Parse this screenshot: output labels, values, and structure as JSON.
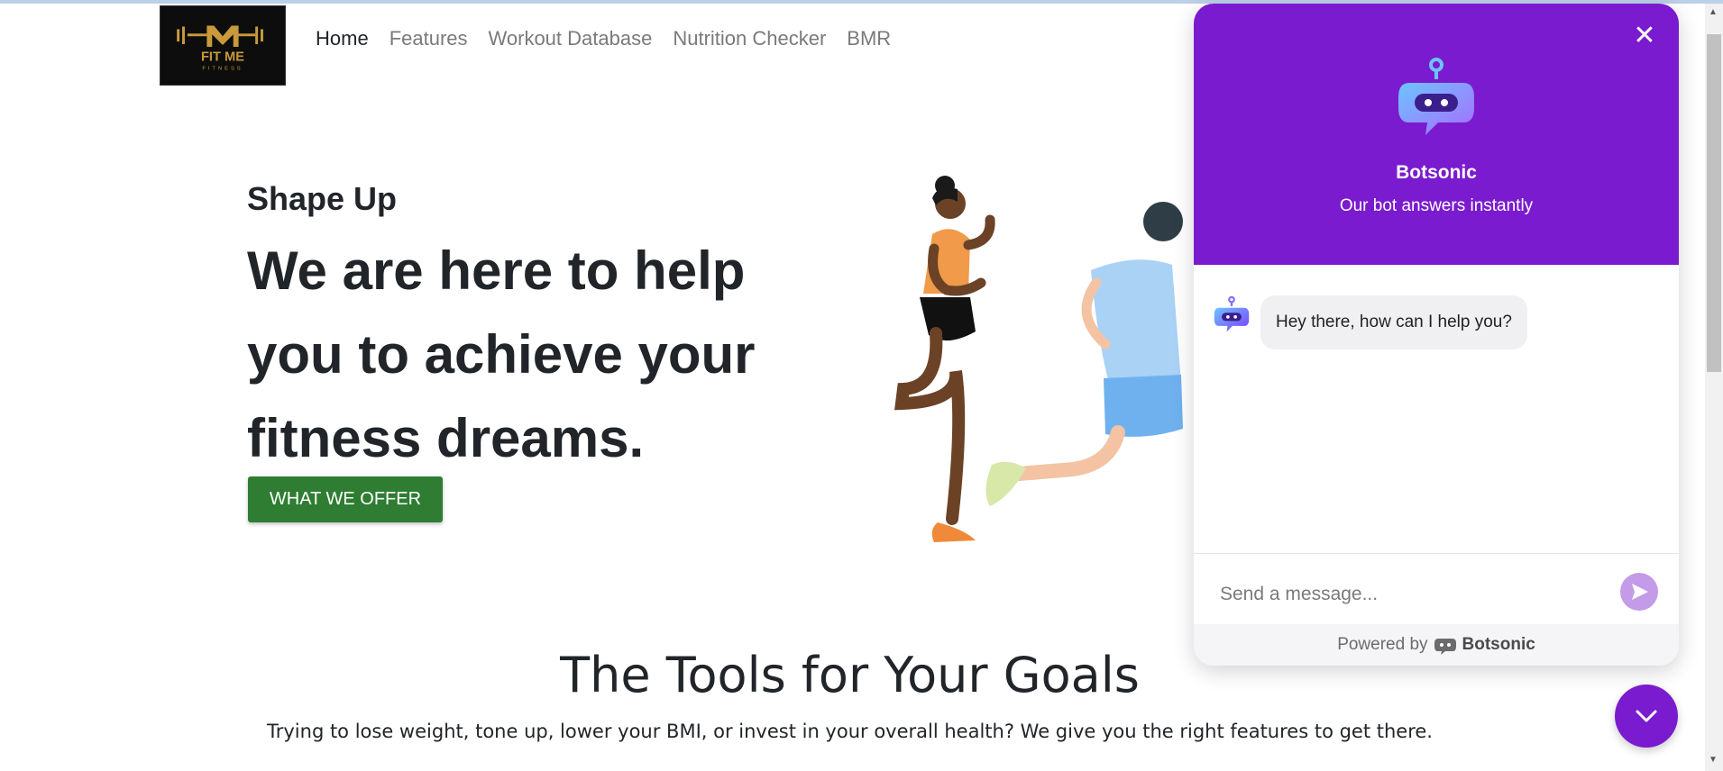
{
  "brand": {
    "logo_text": "FIT ME",
    "logo_subtext": "FITNESS"
  },
  "nav": {
    "items": [
      {
        "label": "Home",
        "active": true
      },
      {
        "label": "Features",
        "active": false
      },
      {
        "label": "Workout Database",
        "active": false
      },
      {
        "label": "Nutrition Checker",
        "active": false
      },
      {
        "label": "BMR",
        "active": false
      }
    ]
  },
  "hero": {
    "eyebrow": "Shape Up",
    "headline": "We are here to help you to achieve your fitness dreams.",
    "cta_label": "WHAT WE OFFER",
    "cta_color": "#2e7d32"
  },
  "tools": {
    "title": "The Tools for Your Goals",
    "subtitle": "Trying to lose weight, tone up, lower your BMI, or invest in your overall health? We give you the right features to get there."
  },
  "chat": {
    "accent_color": "#7a1bcf",
    "bot_name": "Botsonic",
    "tagline": "Our bot answers instantly",
    "messages": [
      {
        "from": "bot",
        "text": "Hey there, how can I help you?"
      }
    ],
    "input_placeholder": "Send a message...",
    "powered_by_label": "Powered by",
    "powered_by_brand": "Botsonic",
    "icons": {
      "close": "close-icon",
      "send": "send-icon",
      "launcher": "chevron-down-icon"
    }
  }
}
